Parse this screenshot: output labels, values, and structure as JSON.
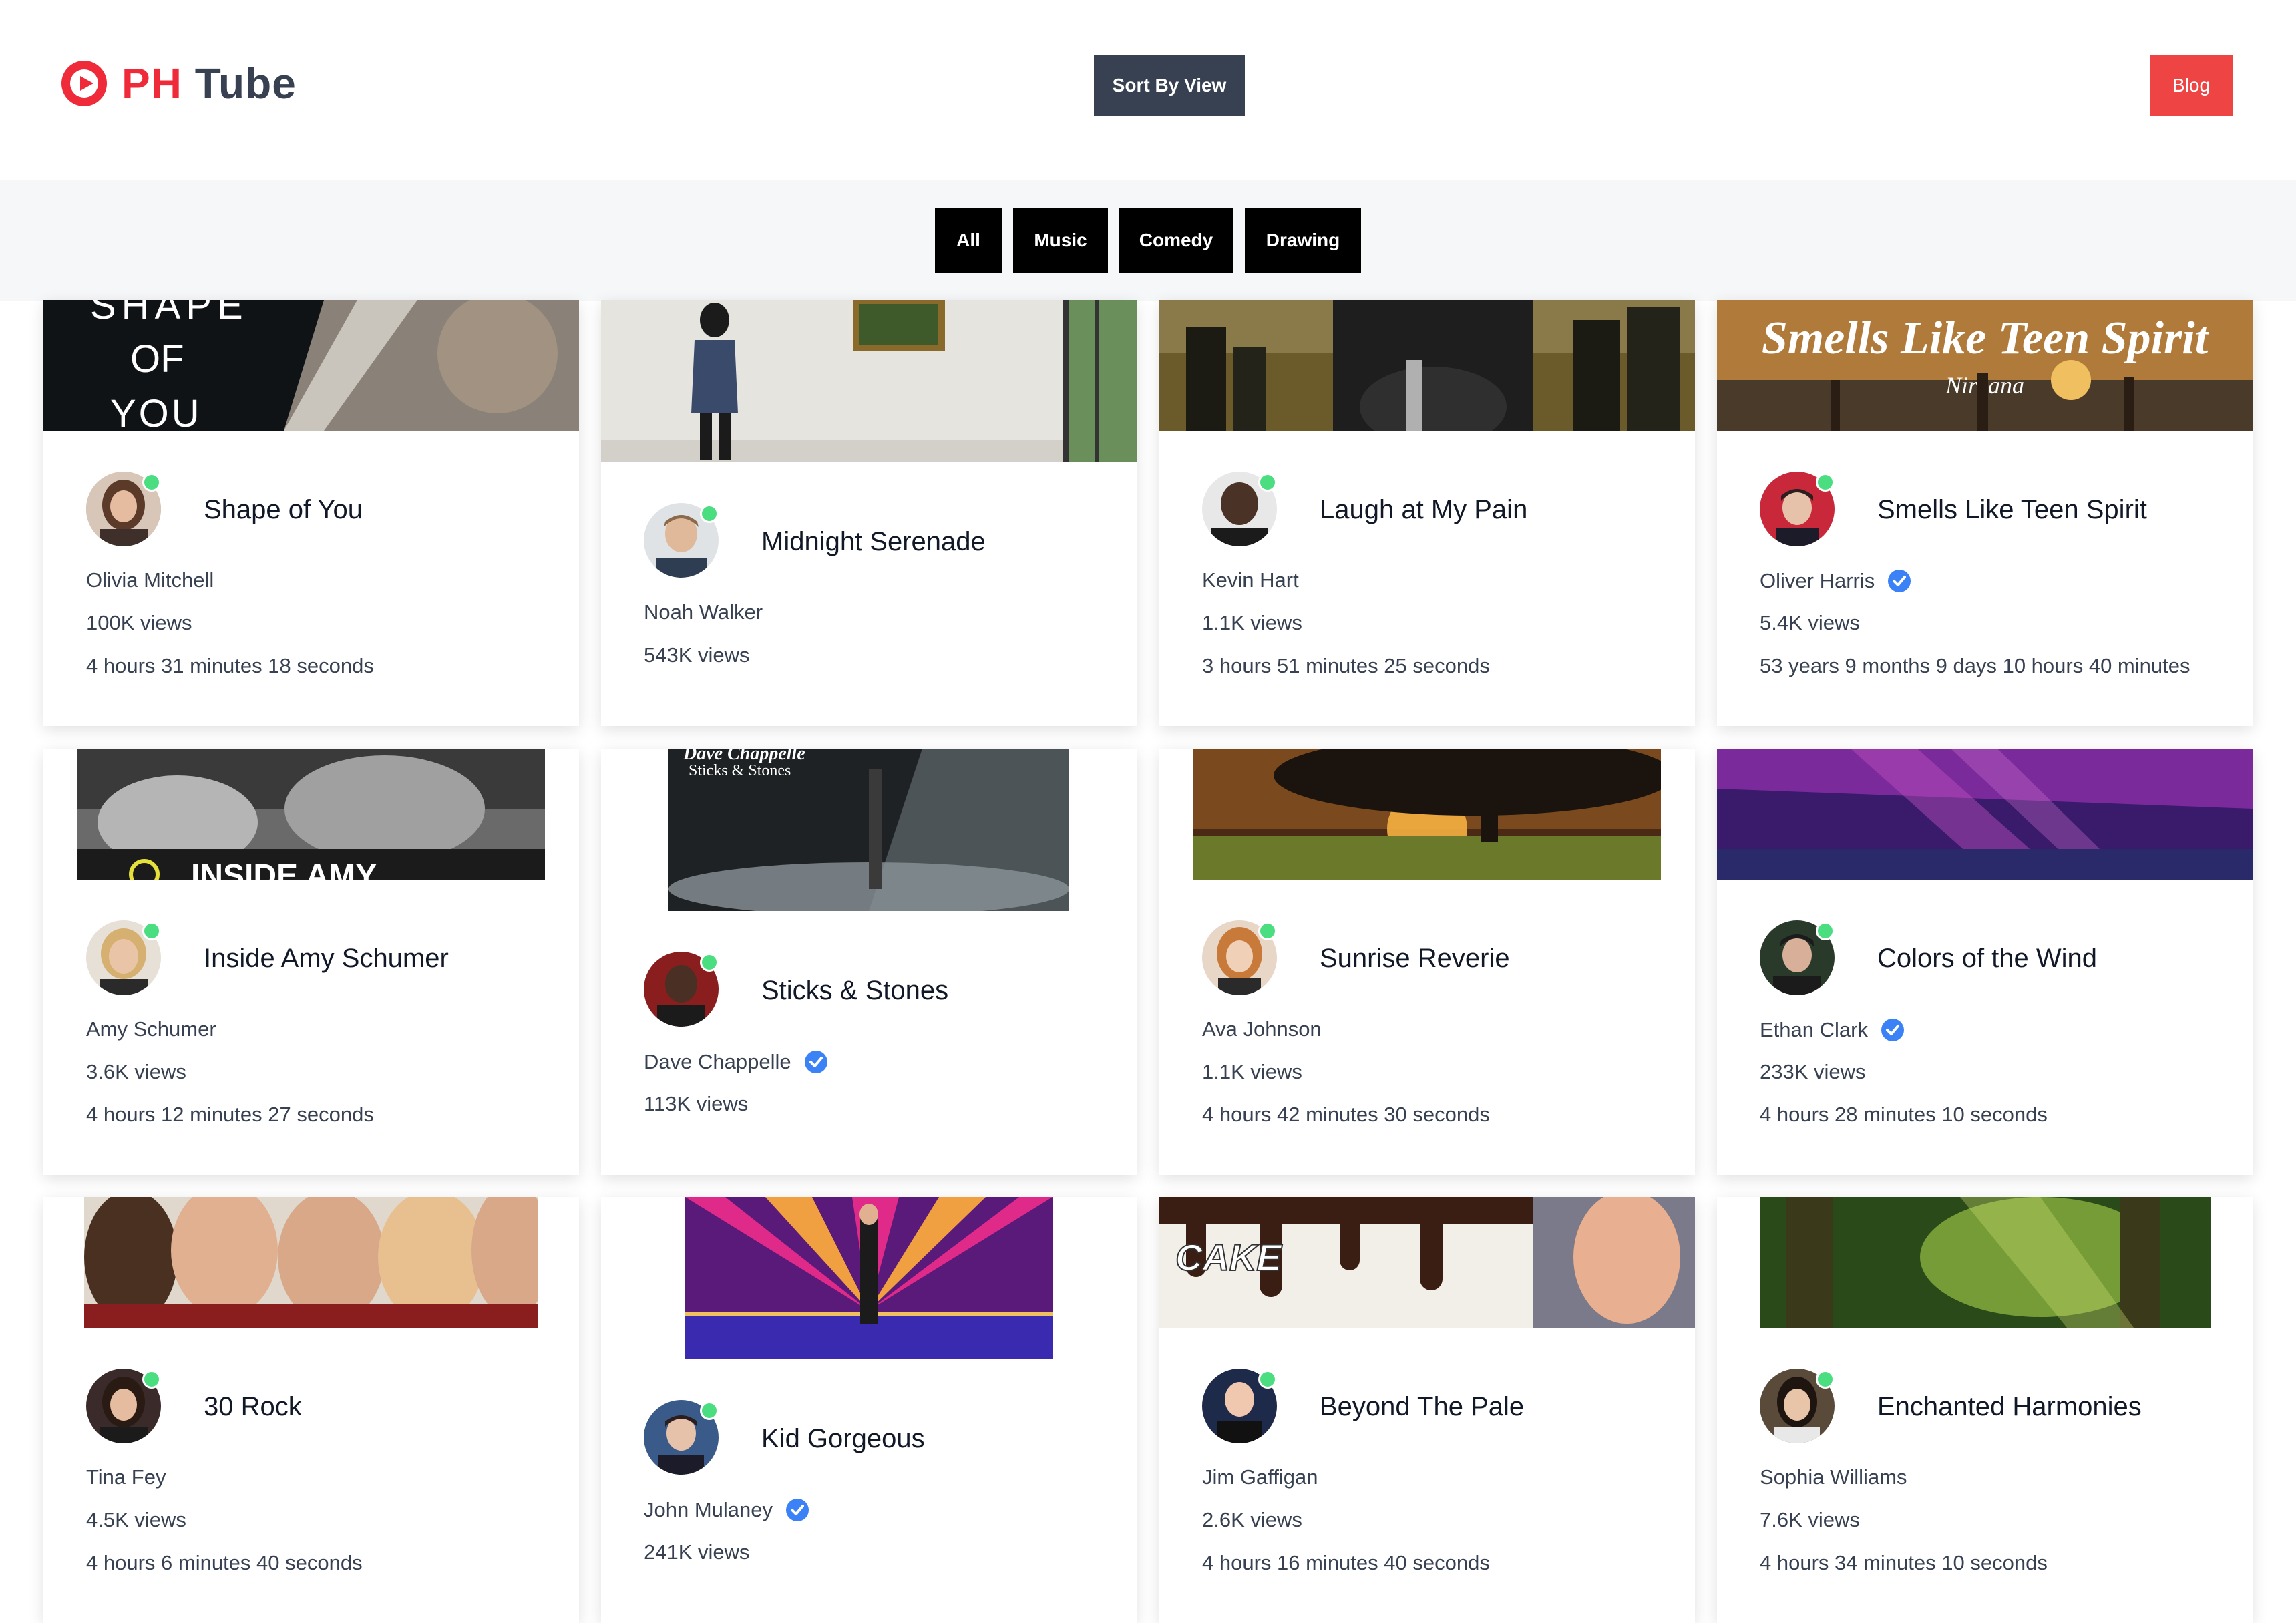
{
  "header": {
    "logo_ph": "PH",
    "logo_tube": "Tube",
    "sort_label": "Sort By View",
    "blog_label": "Blog"
  },
  "categories": [
    "All",
    "Music",
    "Comedy",
    "Drawing"
  ],
  "colors": {
    "brand_red": "#ef2b3a",
    "sort_button": "#374151",
    "blog_button": "#ef4444",
    "category_button": "#000000",
    "verified_badge": "#3b82f6",
    "online_dot": "#4ade80"
  },
  "videos": [
    {
      "title": "Shape of You",
      "author": "Olivia Mitchell",
      "verified": false,
      "views": "100K views",
      "time": "4 hours 31 minutes 18 seconds",
      "thumbnail_text": "SHAPE OF YOU"
    },
    {
      "title": "Midnight Serenade",
      "author": "Noah Walker",
      "verified": false,
      "views": "543K views",
      "time": ""
    },
    {
      "title": "Laugh at My Pain",
      "author": "Kevin Hart",
      "verified": false,
      "views": "1.1K views",
      "time": "3 hours 51 minutes 25 seconds"
    },
    {
      "title": "Smells Like Teen Spirit",
      "author": "Oliver Harris",
      "verified": true,
      "views": "5.4K views",
      "time": "53 years 9 months 9 days 10 hours 40 minutes",
      "thumbnail_text": "Smells Like Teen Spirit",
      "thumbnail_subtext": "Nirvana"
    },
    {
      "title": "Inside Amy Schumer",
      "author": "Amy Schumer",
      "verified": false,
      "views": "3.6K views",
      "time": "4 hours 12 minutes 27 seconds",
      "thumbnail_text": "INSIDE AMY"
    },
    {
      "title": "Sticks & Stones",
      "author": "Dave Chappelle",
      "verified": true,
      "views": "113K views",
      "time": "",
      "thumbnail_text": "Dave Chappelle",
      "thumbnail_subtext": "Sticks & Stones"
    },
    {
      "title": "Sunrise Reverie",
      "author": "Ava Johnson",
      "verified": false,
      "views": "1.1K views",
      "time": "4 hours 42 minutes 30 seconds"
    },
    {
      "title": "Colors of the Wind",
      "author": "Ethan Clark",
      "verified": true,
      "views": "233K views",
      "time": "4 hours 28 minutes 10 seconds"
    },
    {
      "title": "30 Rock",
      "author": "Tina Fey",
      "verified": false,
      "views": "4.5K views",
      "time": "4 hours 6 minutes 40 seconds"
    },
    {
      "title": "Kid Gorgeous",
      "author": "John Mulaney",
      "verified": true,
      "views": "241K views",
      "time": ""
    },
    {
      "title": "Beyond The Pale",
      "author": "Jim Gaffigan",
      "verified": false,
      "views": "2.6K views",
      "time": "4 hours 16 minutes 40 seconds",
      "thumbnail_text": "CAKE"
    },
    {
      "title": "Enchanted Harmonies",
      "author": "Sophia Williams",
      "verified": false,
      "views": "7.6K views",
      "time": "4 hours 34 minutes 10 seconds"
    }
  ]
}
